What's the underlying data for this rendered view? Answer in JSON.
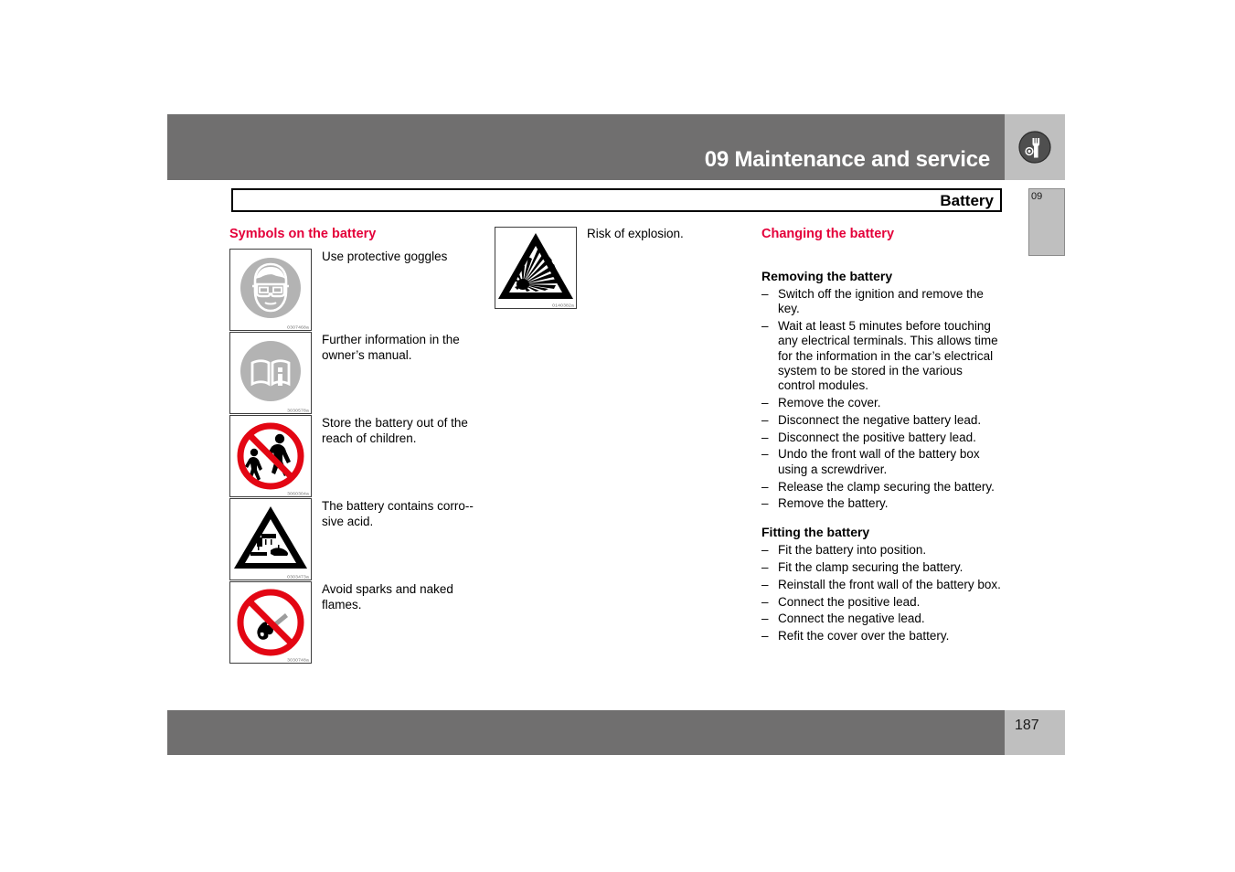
{
  "header": {
    "chapter_title": "09 Maintenance and service",
    "icon": "wrench-icon",
    "section_label": "Battery",
    "chapter_tab": "09"
  },
  "footer": {
    "page_number": "187"
  },
  "colors": {
    "bar_gray": "#706f6f",
    "tab_gray": "#bfbfbf",
    "heading_pink": "#e4003a",
    "warning_red": "#e30613"
  },
  "left_column": {
    "heading": "Symbols on the battery",
    "symbols": [
      {
        "icon": "protective-goggles-icon",
        "code": "0307468a",
        "caption": "Use protective goggles"
      },
      {
        "icon": "owners-manual-book-icon",
        "code": "3030578a",
        "caption": "Further information in the owner’s manual."
      },
      {
        "icon": "no-children-icon",
        "code": "3060304a",
        "caption": "Store the battery out of the reach of children."
      },
      {
        "icon": "corrosive-acid-warning-icon",
        "code": "0303473a",
        "caption": "The battery contains corro-­sive acid."
      },
      {
        "icon": "no-open-flames-icon",
        "code": "3030748a",
        "caption": "Avoid sparks and naked flames."
      }
    ]
  },
  "middle_column": {
    "symbol": {
      "icon": "explosion-risk-icon",
      "code": "0140382a",
      "caption": "Risk of explosion."
    }
  },
  "right_column": {
    "heading": "Changing the battery",
    "sections": [
      {
        "subheading": "Removing the battery",
        "bullet_char": "–",
        "items": [
          "Switch off the ignition and remove the key.",
          "Wait at least 5 minutes before touching any electrical terminals. This allows time for the information in the car’s electrical system to be stored in the various control modules.",
          "Remove the cover.",
          "Disconnect the negative battery lead.",
          "Disconnect the positive battery lead.",
          "Undo the front wall of the battery box using a screwdriver.",
          "Release the clamp securing the battery.",
          "Remove the battery."
        ]
      },
      {
        "subheading": "Fitting the battery",
        "bullet_char": "–",
        "items": [
          "Fit the battery into position.",
          "Fit the clamp securing the battery.",
          "Reinstall the front wall of the battery box.",
          "Connect the positive lead.",
          "Connect the negative lead.",
          "Refit the cover over the battery."
        ]
      }
    ]
  }
}
